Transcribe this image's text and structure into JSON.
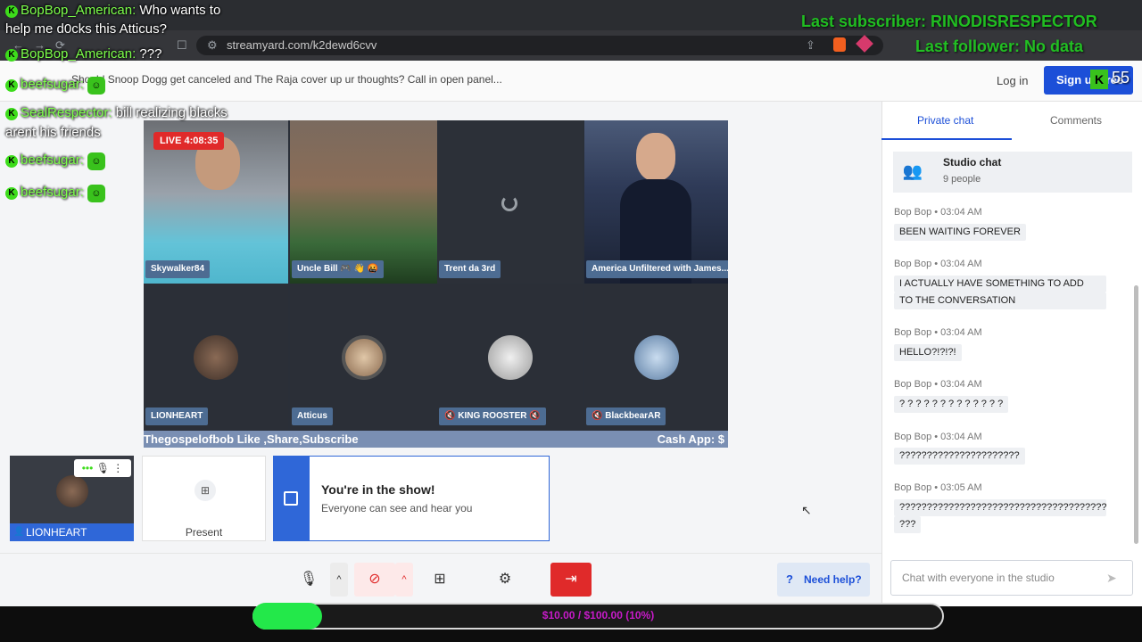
{
  "browser": {
    "url": "streamyard.com/k2dewd6cvv"
  },
  "header": {
    "title": "Should Snoop Dogg get canceled and The Raja cover up ur thoughts? Call in open panel...",
    "login_label": "Log in",
    "signup_label": "Sign up free",
    "overlay_count": "55"
  },
  "stage": {
    "live_badge": "LIVE 4:08:35",
    "tiles": [
      {
        "name": "Skywalker84"
      },
      {
        "name": "Uncle Bill 🎮 👋 🤬"
      },
      {
        "name": "Trent da 3rd"
      },
      {
        "name": "America Unfiltered with James..."
      },
      {
        "name": "LIONHEART"
      },
      {
        "name": "Atticus"
      },
      {
        "name": "🔇 KING ROOSTER 🔇"
      },
      {
        "name": "🔇 BlackbearAR"
      }
    ],
    "ticker_left": "Thegospelofbob Like ,Share,Subscribe",
    "ticker_right": "Cash App: $"
  },
  "studio": {
    "self_name": "LIONHEART",
    "present_label": "Present",
    "show_title": "You're in the show!",
    "show_sub": "Everyone can see and hear you",
    "need_help": "Need help?"
  },
  "chat": {
    "tab_private": "Private chat",
    "tab_comments": "Comments",
    "studio_title": "Studio chat",
    "studio_sub": "9 people",
    "messages": [
      {
        "meta": "Bop Bop  •  03:04 AM",
        "text": "BEEN WAITING FOREVER"
      },
      {
        "meta": "Bop Bop  •  03:04 AM",
        "text": "I ACTUALLY HAVE SOMETHING TO ADD"
      },
      {
        "meta": "",
        "text": "TO THE CONVERSATION"
      },
      {
        "meta": "Bop Bop  •  03:04 AM",
        "text": "HELLO?!?!?!"
      },
      {
        "meta": "Bop Bop  •  03:04 AM",
        "text": "? ? ? ? ? ? ? ? ? ? ? ? ?"
      },
      {
        "meta": "Bop Bop  •  03:04 AM",
        "text": "??????????????????????"
      },
      {
        "meta": "Bop Bop  •  03:05 AM",
        "text": "????????????????????????????????????????"
      },
      {
        "meta": "",
        "text": "???"
      }
    ],
    "input_placeholder": "Chat with everyone in the studio"
  },
  "overlay_chat": {
    "lines": [
      {
        "name": "BopBop_American:",
        "text": "Who wants to"
      },
      {
        "name": "",
        "text": "help me d0cks this Atticus?"
      },
      {
        "name": "BopBop_American:",
        "text": "???"
      },
      {
        "name": "beefsugar:",
        "text": ""
      },
      {
        "name": "SealRespector:",
        "text": "bill realizing blacks"
      },
      {
        "name": "",
        "text": "arent his friends"
      },
      {
        "name": "beefsugar:",
        "text": ""
      },
      {
        "name": "beefsugar:",
        "text": ""
      }
    ],
    "last_subscriber": "Last subscriber: RINODISRESPECTOR",
    "last_follower": "Last follower: No data"
  },
  "goal": {
    "text": "$10.00 / $100.00 (10%)",
    "progress": 0.1
  },
  "colors": {
    "accent": "#1c4fd8",
    "live": "#e02a2a",
    "goal_fill": "#23e84a",
    "goal_text": "#c71ac9"
  }
}
